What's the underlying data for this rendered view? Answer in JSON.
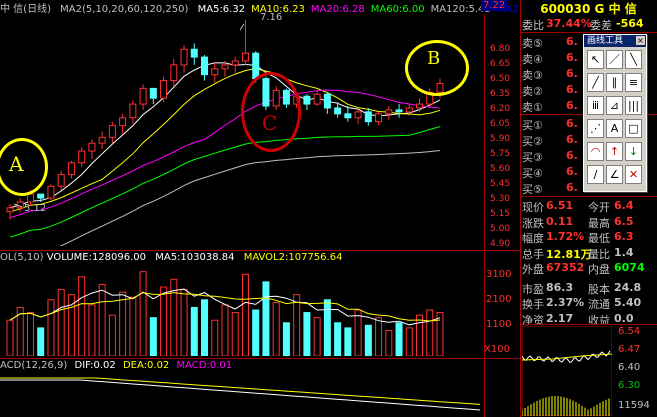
{
  "header": {
    "title": "中 信(日线)",
    "ma_param_label": "MA2(5,10,20,60,120,250)",
    "ma_values": [
      {
        "text": "MA5:6.32",
        "color": "#ffffff"
      },
      {
        "text": "MA10:6.23",
        "color": "#ffff00"
      },
      {
        "text": "MA20:6.28",
        "color": "#ff00ff"
      },
      {
        "text": "MA60:6.00",
        "color": "#00ff00"
      },
      {
        "text": "MA120:5.43",
        "color": "#c0c0c0"
      },
      {
        "text": "MA2",
        "color": "#0000ff"
      }
    ],
    "corner_price": "7.22"
  },
  "price_axis": [
    "6.80",
    "6.65",
    "6.50",
    "6.35",
    "6.20",
    "6.05",
    "5.90",
    "5.75",
    "5.60",
    "5.45",
    "5.30",
    "5.15",
    "5.00",
    "4.90"
  ],
  "annotations": {
    "high_label": "7.16",
    "low_label": "5.12",
    "circle_a": "A",
    "circle_b": "B",
    "circle_c": "C"
  },
  "volume_header": {
    "label": "OL(5,10)",
    "volume": "VOLUME:128096.00",
    "ma5": "MA5:103038.84",
    "mavol2": "MAVOL2:107756.64"
  },
  "volume_axis": [
    "3100",
    "2100",
    "1100"
  ],
  "volume_unit": "X100",
  "macd_header": {
    "label": "ACD(12,26,9)",
    "dif": "DIF:0.02",
    "dea": "DEA:0.02",
    "macd": "MACD:0.01"
  },
  "quote": {
    "code": "600030",
    "market": "G",
    "name": "中 信",
    "weibi_label": "委比",
    "weibi_value": "37.44%",
    "weicha_label": "委差",
    "weicha_value": "-564",
    "sells": [
      {
        "label": "卖⑤",
        "price": "6."
      },
      {
        "label": "卖④",
        "price": "6."
      },
      {
        "label": "卖③",
        "price": "6."
      },
      {
        "label": "卖②",
        "price": "6."
      },
      {
        "label": "卖①",
        "price": "6."
      }
    ],
    "buys": [
      {
        "label": "买①",
        "price": "6."
      },
      {
        "label": "买②",
        "price": "6."
      },
      {
        "label": "买③",
        "price": "6."
      },
      {
        "label": "买④",
        "price": "6."
      },
      {
        "label": "买⑤",
        "price": "6."
      }
    ],
    "stats": [
      {
        "l1": "现价",
        "v1": "6.51",
        "l2": "今开",
        "v2": "6.4"
      },
      {
        "l1": "涨跌",
        "v1": "0.11",
        "l2": "最高",
        "v2": "6.5"
      },
      {
        "l1": "幅度",
        "v1": "1.72%",
        "l2": "最低",
        "v2": "6.3"
      },
      {
        "l1": "总手",
        "v1": "12.81万",
        "l2": "量比",
        "v2": "1.4"
      },
      {
        "l1": "外盘",
        "v1": "67352",
        "l2": "内盘",
        "v2": "6074"
      },
      {
        "l1": "市盈",
        "v1": "86.3",
        "l2": "股本",
        "v2": "24.8"
      },
      {
        "l1": "换手",
        "v1": "2.37%",
        "l2": "流通",
        "v2": "5.40"
      },
      {
        "l1": "净资",
        "v1": "2.17",
        "l2": "收益",
        "v2": "0.0"
      }
    ]
  },
  "toolbox": {
    "title": "画线工具"
  },
  "mini_chart": {
    "labels": [
      "6.54",
      "6.47",
      "6.40",
      "6.30",
      "11594"
    ],
    "label_colors": [
      "#ff3030",
      "#ff3030",
      "#c0c0c0",
      "#00c000",
      "#c0c0c0"
    ]
  },
  "chart_data": [
    {
      "type": "candlestick",
      "title": "中 信(日线)",
      "ylim": [
        4.85,
        7.22
      ],
      "series": [
        {
          "name": "MA5",
          "color": "#ffffff"
        },
        {
          "name": "MA10",
          "color": "#ffff00"
        },
        {
          "name": "MA20",
          "color": "#ff00ff"
        },
        {
          "name": "MA60",
          "color": "#00ff00"
        },
        {
          "name": "MA120",
          "color": "#c0c0c0"
        }
      ],
      "candles": [
        [
          5.2,
          5.28,
          5.12,
          5.24
        ],
        [
          5.24,
          5.34,
          5.2,
          5.3
        ],
        [
          5.3,
          5.42,
          5.26,
          5.38
        ],
        [
          5.38,
          5.36,
          5.3,
          5.34
        ],
        [
          5.34,
          5.48,
          5.32,
          5.46
        ],
        [
          5.46,
          5.62,
          5.42,
          5.58
        ],
        [
          5.58,
          5.72,
          5.54,
          5.7
        ],
        [
          5.7,
          5.86,
          5.66,
          5.82
        ],
        [
          5.82,
          5.94,
          5.74,
          5.9
        ],
        [
          5.9,
          6.02,
          5.84,
          5.96
        ],
        [
          5.96,
          6.12,
          5.9,
          6.08
        ],
        [
          6.08,
          6.2,
          6.0,
          6.16
        ],
        [
          6.16,
          6.34,
          6.1,
          6.3
        ],
        [
          6.3,
          6.5,
          6.24,
          6.46
        ],
        [
          6.46,
          6.44,
          6.3,
          6.36
        ],
        [
          6.36,
          6.58,
          6.32,
          6.54
        ],
        [
          6.54,
          6.76,
          6.48,
          6.7
        ],
        [
          6.7,
          6.9,
          6.62,
          6.86
        ],
        [
          6.86,
          6.92,
          6.7,
          6.78
        ],
        [
          6.78,
          6.8,
          6.54,
          6.6
        ],
        [
          6.6,
          6.72,
          6.52,
          6.66
        ],
        [
          6.66,
          6.74,
          6.58,
          6.7
        ],
        [
          6.7,
          6.78,
          6.62,
          6.74
        ],
        [
          6.74,
          7.16,
          6.7,
          6.82
        ],
        [
          6.82,
          6.84,
          6.52,
          6.56
        ],
        [
          6.56,
          6.58,
          6.24,
          6.28
        ],
        [
          6.28,
          6.48,
          6.24,
          6.44
        ],
        [
          6.44,
          6.46,
          6.26,
          6.3
        ],
        [
          6.3,
          6.42,
          6.26,
          6.38
        ],
        [
          6.38,
          6.4,
          6.24,
          6.3
        ],
        [
          6.3,
          6.44,
          6.28,
          6.4
        ],
        [
          6.4,
          6.42,
          6.2,
          6.26
        ],
        [
          6.26,
          6.32,
          6.16,
          6.2
        ],
        [
          6.2,
          6.28,
          6.12,
          6.16
        ],
        [
          6.16,
          6.24,
          6.1,
          6.22
        ],
        [
          6.22,
          6.26,
          6.08,
          6.12
        ],
        [
          6.12,
          6.22,
          6.08,
          6.2
        ],
        [
          6.2,
          6.28,
          6.14,
          6.24
        ],
        [
          6.24,
          6.3,
          6.16,
          6.22
        ],
        [
          6.22,
          6.3,
          6.18,
          6.26
        ],
        [
          6.26,
          6.36,
          6.22,
          6.3
        ],
        [
          6.3,
          6.46,
          6.26,
          6.42
        ],
        [
          6.42,
          6.56,
          6.36,
          6.51
        ]
      ]
    },
    {
      "type": "bar",
      "title": "VOLUME",
      "ylim": [
        0,
        3600
      ],
      "values": [
        1400,
        1900,
        1700,
        1100,
        2200,
        2600,
        2400,
        3100,
        2000,
        2800,
        1600,
        2500,
        2300,
        3300,
        1500,
        2700,
        3000,
        2600,
        1900,
        2200,
        1400,
        2000,
        1700,
        3200,
        1800,
        2900,
        2100,
        1300,
        2400,
        1700,
        1500,
        2200,
        1300,
        1100,
        1800,
        1200,
        1500,
        1000,
        1300,
        1100,
        1600,
        1800,
        1700
      ]
    }
  ]
}
